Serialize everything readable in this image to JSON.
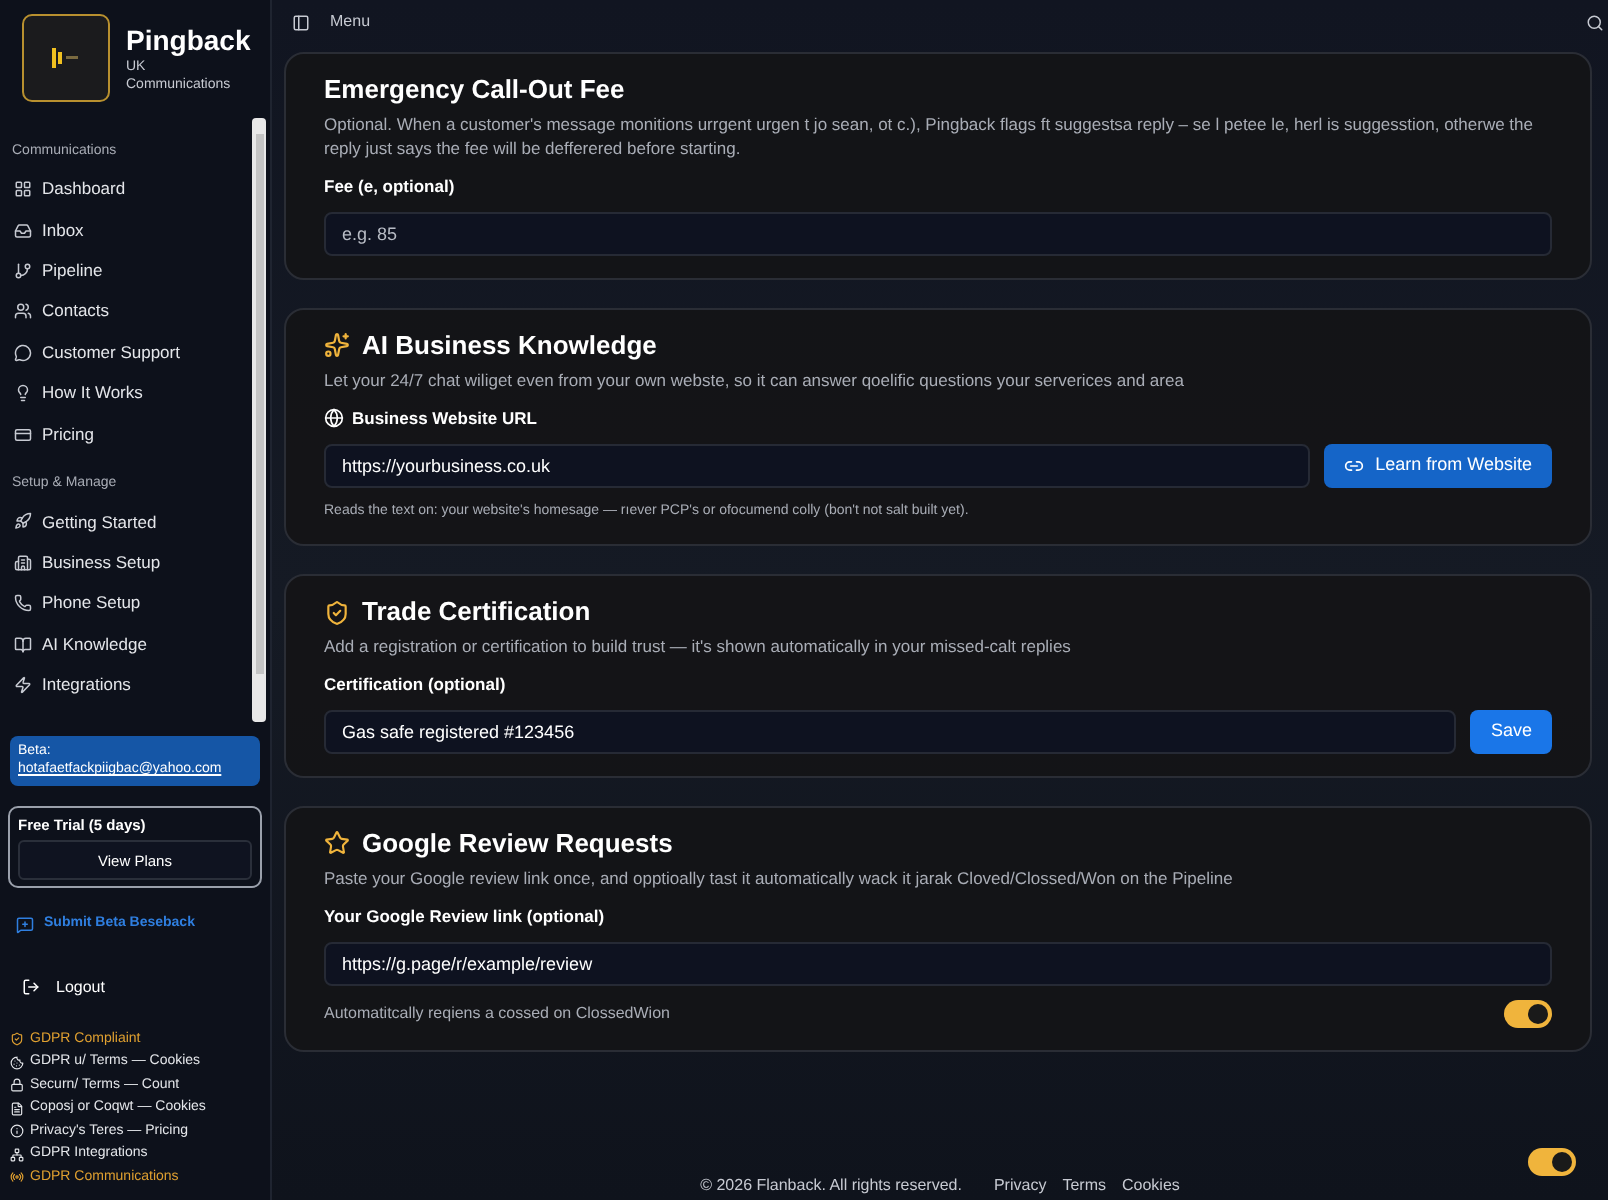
{
  "brand": {
    "name": "Pingback",
    "line_1": "UK",
    "line_2": "Communications"
  },
  "sidebar": {
    "sections": [
      {
        "title": "Communications",
        "items": [
          {
            "label": "Dashboard",
            "selected": false
          },
          {
            "label": "Inbox",
            "selected": false
          },
          {
            "label": "Pipeline",
            "selected": false
          },
          {
            "label": "Contacts",
            "selected": false
          },
          {
            "label": "Customer Support",
            "selected": false
          },
          {
            "label": "How It Works",
            "selected": false
          },
          {
            "label": "Pricing",
            "selected": false
          }
        ]
      },
      {
        "title": "Setup & Manage",
        "items": [
          {
            "label": "Getting Started",
            "selected": false
          },
          {
            "label": "Business Setup",
            "selected": false
          },
          {
            "label": "Phone Setup",
            "selected": false
          },
          {
            "label": "AI Knowledge",
            "selected": false
          },
          {
            "label": "Integrations",
            "selected": false
          }
        ]
      }
    ]
  },
  "beta": {
    "label": "Beta:",
    "email": "hotafaetfackpiigbac@yahoo.com"
  },
  "trial": {
    "label": "Free Trial (5 days)",
    "button": "View Plans"
  },
  "feedback": "Submit Beta Beseback",
  "logout": "Logout",
  "compliance": [
    {
      "label": "GDPR Compliaint",
      "highlighted": true
    },
    {
      "label": "GDPR u/ Terms — Cookies",
      "highlighted": false
    },
    {
      "label": "Securn/ Terms — Count",
      "highlighted": false
    },
    {
      "label": "Coposj or Coqwt — Cookies",
      "highlighted": false
    },
    {
      "label": "Privacy's Teres — Pricing",
      "highlighted": false
    },
    {
      "label": "GDPR Integrations",
      "highlighted": false
    },
    {
      "label": "GDPR Communications",
      "highlighted": true
    }
  ],
  "topbar": {
    "menu": "Menu"
  },
  "cards": [
    {
      "kind": "fee",
      "title": "Emergency Call-Out Fee",
      "description": "Optional. When a customer's message monitions urrgent urgen t jo sean, ot  c.), Pingback flags ft suggestsa reply – se l petee le, herl is suggesstion, otherwe the reply just says the fee will be defferered before starting.",
      "field_label": "Fee (e, optional)",
      "placeholder": "e.g. 85"
    },
    {
      "kind": "knowledge",
      "title": "AI Business Knowledge",
      "description": "Let your 24/7 chat wiliget even from your own webste, so it can answer qoelific questions your serverices and area",
      "field_label": "Business Website URL",
      "value": "https://yourbusiness.co.uk",
      "button": "Learn from Website",
      "note": "Reads the text on: your website's homesage — rıever PCP's or ofocumend colly (bon't not salt built yet)."
    },
    {
      "kind": "certification",
      "title": "Trade Certification",
      "description": "Add a registration or certification to build trust — it's shown automatically in your missed-calt replies",
      "field_label": "Certification (optional)",
      "value": "Gas safe registered #123456",
      "button": "Save"
    },
    {
      "kind": "review",
      "title": "Google Review Requests",
      "description": "Paste your Google review link once, and opptioally tast it automatically wack it jarak Cloved/Clossed/Won on the Pipeline",
      "field_label": "Your Google Review link (optional)",
      "value": "https://g.page/r/example/review",
      "toggle_label": "Automatitcally reqiens a cossed on ClossedWion",
      "toggle_on": true
    }
  ],
  "floating_toggle": {
    "on": true
  },
  "footer": {
    "copyright": "© 2026 Flanback. All rights reserved.",
    "links": [
      "Privacy",
      "Terms",
      "Cookies"
    ]
  }
}
